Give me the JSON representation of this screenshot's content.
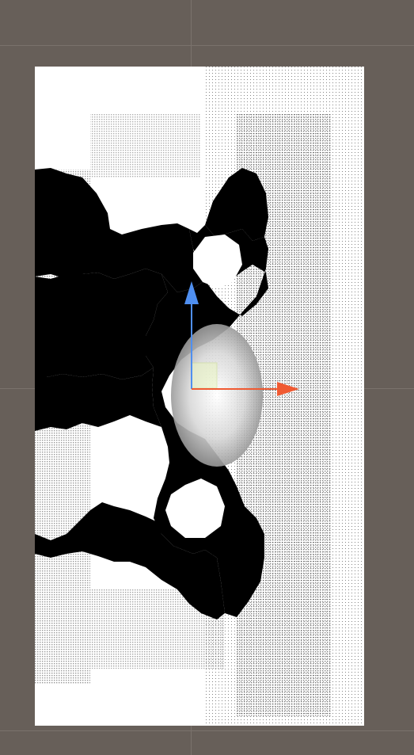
{
  "window": {
    "background_color": "#675f59",
    "grid_color": "#7a726c"
  },
  "texture": {
    "background_color": "#ffffff",
    "ink_color": "#000000",
    "halftone_color": "#1a1a1a"
  },
  "gizmo": {
    "type": "move-tool",
    "x_axis_color": "#f05a32",
    "y_axis_color": "#4f8ff0",
    "plane_handle_color": "#e9f5c0"
  }
}
